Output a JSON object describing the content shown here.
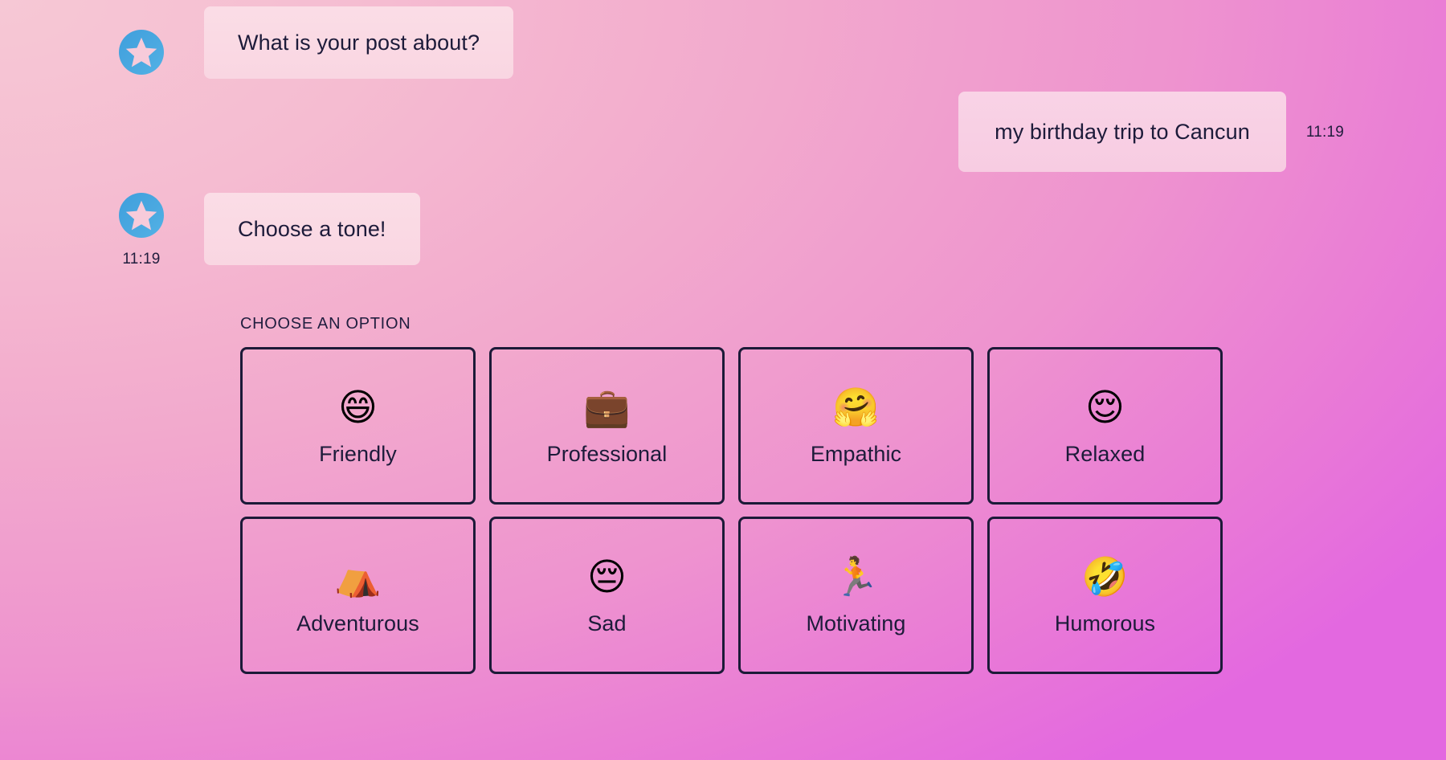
{
  "theme": {
    "background_from": "#f6c8d5",
    "background_to": "#e368e0",
    "bubble_bot_bg": "#fbdde6",
    "bubble_user_bg": "#f9d3e6",
    "text_color": "#1d1b3a",
    "card_border": "#1c1a38",
    "avatar_bg": "#4aa8e0",
    "avatar_star": "#f7cbda"
  },
  "conversation": {
    "messages": [
      {
        "id": "prompt",
        "sender": "bot",
        "avatar_icon": "star-avatar-icon",
        "text": "What is your post about?",
        "timestamp": ""
      },
      {
        "id": "user-reply",
        "sender": "user",
        "text": "my birthday trip to Cancun",
        "timestamp": "11:19"
      },
      {
        "id": "tone-prompt",
        "sender": "bot",
        "avatar_icon": "star-avatar-icon",
        "text": "Choose a tone!",
        "timestamp": "11:19"
      }
    ]
  },
  "options": {
    "heading": "CHOOSE AN OPTION",
    "items": [
      {
        "label": "Friendly",
        "emoji": "😄",
        "icon_name": "grinning-smiling-eyes-emoji"
      },
      {
        "label": "Professional",
        "emoji": "💼",
        "icon_name": "briefcase-emoji"
      },
      {
        "label": "Empathic",
        "emoji": "🤗",
        "icon_name": "hugging-face-emoji"
      },
      {
        "label": "Relaxed",
        "emoji": "😌",
        "icon_name": "relieved-face-emoji"
      },
      {
        "label": "Adventurous",
        "emoji": "⛺",
        "icon_name": "tent-emoji"
      },
      {
        "label": "Sad",
        "emoji": "😔",
        "icon_name": "pensive-face-emoji"
      },
      {
        "label": "Motivating",
        "emoji": "🏃",
        "icon_name": "runner-emoji"
      },
      {
        "label": "Humorous",
        "emoji": "🤣",
        "icon_name": "rofl-emoji"
      }
    ]
  }
}
